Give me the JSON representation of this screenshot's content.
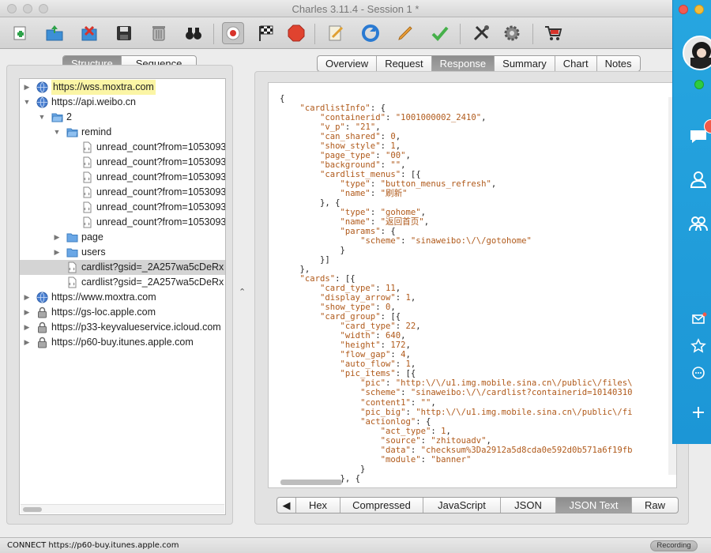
{
  "window": {
    "title": "Charles 3.11.4 - Session 1 *"
  },
  "toolbar": {
    "buttons": [
      {
        "icon": "new-session-icon"
      },
      {
        "icon": "open-session-icon"
      },
      {
        "icon": "close-session-icon"
      },
      {
        "icon": "save-icon"
      },
      {
        "icon": "trash-icon"
      },
      {
        "icon": "find-icon"
      },
      {
        "icon": "record-icon"
      },
      {
        "icon": "throttle-flag-icon"
      },
      {
        "icon": "breakpoint-stop-icon"
      },
      {
        "icon": "compose-icon"
      },
      {
        "icon": "repeat-icon"
      },
      {
        "icon": "edit-pencil-icon"
      },
      {
        "icon": "validate-check-icon"
      },
      {
        "icon": "tools-icon"
      },
      {
        "icon": "settings-gear-icon"
      },
      {
        "icon": "shopping-cart-icon"
      }
    ]
  },
  "view_tabs": [
    "Structure",
    "Sequence"
  ],
  "view_selected": "Structure",
  "detail_tabs": [
    "Overview",
    "Request",
    "Response",
    "Summary",
    "Chart",
    "Notes"
  ],
  "detail_selected": "Response",
  "tree": [
    {
      "label": "https://wss.moxtra.com",
      "level": 0,
      "arrow": "▶",
      "icon": "globe",
      "highlight": true
    },
    {
      "label": "https://api.weibo.cn",
      "level": 0,
      "arrow": "▼",
      "icon": "globe"
    },
    {
      "label": "2",
      "level": 1,
      "arrow": "▼",
      "icon": "folder-open"
    },
    {
      "label": "remind",
      "level": 2,
      "arrow": "▼",
      "icon": "folder-open"
    },
    {
      "label": "unread_count?from=1053093",
      "level": 3,
      "arrow": "",
      "icon": "file"
    },
    {
      "label": "unread_count?from=1053093",
      "level": 3,
      "arrow": "",
      "icon": "file"
    },
    {
      "label": "unread_count?from=1053093",
      "level": 3,
      "arrow": "",
      "icon": "file"
    },
    {
      "label": "unread_count?from=1053093",
      "level": 3,
      "arrow": "",
      "icon": "file"
    },
    {
      "label": "unread_count?from=1053093",
      "level": 3,
      "arrow": "",
      "icon": "file"
    },
    {
      "label": "unread_count?from=1053093",
      "level": 3,
      "arrow": "",
      "icon": "file"
    },
    {
      "label": "page",
      "level": 2,
      "arrow": "▶",
      "icon": "folder"
    },
    {
      "label": "users",
      "level": 2,
      "arrow": "▶",
      "icon": "folder"
    },
    {
      "label": "cardlist?gsid=_2A257wa5cDeRx",
      "level": 2,
      "arrow": "",
      "icon": "file",
      "selected": true
    },
    {
      "label": "cardlist?gsid=_2A257wa5cDeRx",
      "level": 2,
      "arrow": "",
      "icon": "file"
    },
    {
      "label": "https://www.moxtra.com",
      "level": 0,
      "arrow": "▶",
      "icon": "globe"
    },
    {
      "label": "https://gs-loc.apple.com",
      "level": 0,
      "arrow": "▶",
      "icon": "lock"
    },
    {
      "label": "https://p33-keyvalueservice.icloud.com",
      "level": 0,
      "arrow": "▶",
      "icon": "lock"
    },
    {
      "label": "https://p60-buy.itunes.apple.com",
      "level": 0,
      "arrow": "▶",
      "icon": "lock"
    }
  ],
  "json_lines": [
    "{",
    "    \"cardlistInfo\": {",
    "        \"containerid\": \"1001000002_2410\",",
    "        \"v_p\": \"21\",",
    "        \"can_shared\": 0,",
    "        \"show_style\": 1,",
    "        \"page_type\": \"00\",",
    "        \"background\": \"\",",
    "        \"cardlist_menus\": [{",
    "            \"type\": \"button_menus_refresh\",",
    "            \"name\": \"刷新\"",
    "        }, {",
    "            \"type\": \"gohome\",",
    "            \"name\": \"返回首页\",",
    "            \"params\": {",
    "                \"scheme\": \"sinaweibo:\\/\\/gotohome\"",
    "            }",
    "        }]",
    "    },",
    "    \"cards\": [{",
    "        \"card_type\": 11,",
    "        \"display_arrow\": 1,",
    "        \"show_type\": 0,",
    "        \"card_group\": [{",
    "            \"card_type\": 22,",
    "            \"width\": 640,",
    "            \"height\": 172,",
    "            \"flow_gap\": 4,",
    "            \"auto_flow\": 1,",
    "            \"pic_items\": [{",
    "                \"pic\": \"http:\\/\\/u1.img.mobile.sina.cn\\/public\\/files\\",
    "                \"scheme\": \"sinaweibo:\\/\\/cardlist?containerid=10140310",
    "                \"content1\": \"\",",
    "                \"pic_big\": \"http:\\/\\/u1.img.mobile.sina.cn\\/public\\/fi",
    "                \"actionlog\": {",
    "                    \"act_type\": 1,",
    "                    \"source\": \"zhitouadv\",",
    "                    \"data\": \"checksum%3Da2912a5d8cda0e592d0b571a6f19fb",
    "                    \"module\": \"banner\"",
    "                }",
    "            }, {"
  ],
  "format_tabs": [
    "◀",
    "Hex",
    "Compressed",
    "JavaScript",
    "JSON",
    "JSON Text",
    "Raw"
  ],
  "format_selected": "JSON Text",
  "status": {
    "text": "CONNECT https://p60-buy.itunes.apple.com",
    "recording": "Recording"
  },
  "colors": {
    "json_key": "#b05a1b",
    "overlay_blue": "#1f9ad9",
    "highlight": "#fbf5a5"
  }
}
